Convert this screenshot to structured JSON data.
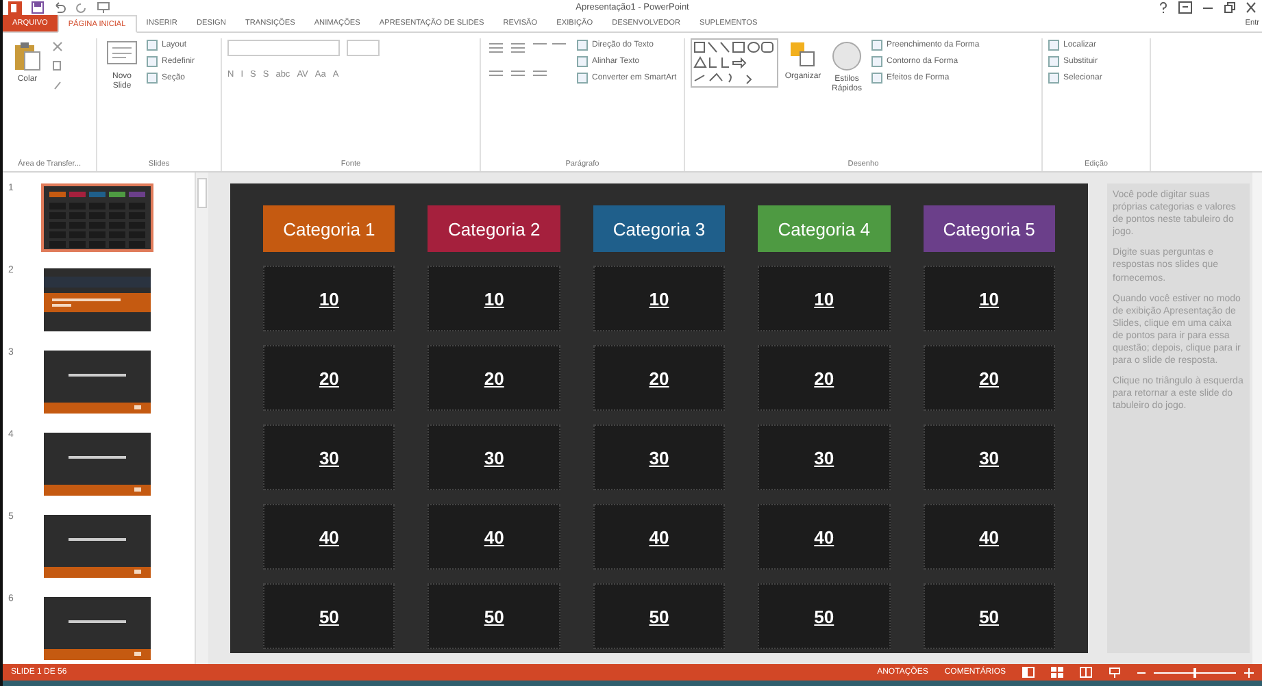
{
  "window": {
    "title": "Apresentação1 - PowerPoint"
  },
  "ribbon_tabs": [
    {
      "label": "ARQUIVO",
      "kind": "file",
      "selected": false
    },
    {
      "label": "PÁGINA INICIAL",
      "kind": "tab",
      "selected": true
    },
    {
      "label": "INSERIR",
      "kind": "tab",
      "selected": false
    },
    {
      "label": "DESIGN",
      "kind": "tab",
      "selected": false
    },
    {
      "label": "TRANSIÇÕES",
      "kind": "tab",
      "selected": false
    },
    {
      "label": "ANIMAÇÕES",
      "kind": "tab",
      "selected": false
    },
    {
      "label": "APRESENTAÇÃO DE SLIDES",
      "kind": "tab",
      "selected": false
    },
    {
      "label": "REVISÃO",
      "kind": "tab",
      "selected": false
    },
    {
      "label": "EXIBIÇÃO",
      "kind": "tab",
      "selected": false
    },
    {
      "label": "DESENVOLVEDOR",
      "kind": "tab",
      "selected": false
    },
    {
      "label": "SUPLEMENTOS",
      "kind": "tab",
      "selected": false
    }
  ],
  "account": "Entr",
  "ribbon_groups": [
    {
      "label": "Área de Transfer...",
      "kind": "clipboard",
      "large": [
        "Colar"
      ]
    },
    {
      "label": "Slides",
      "kind": "slides",
      "large": [
        "Novo Slide"
      ],
      "small": [
        "Layout",
        "Redefinir",
        "Seção"
      ]
    },
    {
      "label": "Fonte",
      "kind": "font",
      "format": [
        "N",
        "I",
        "S",
        "S",
        "abc",
        "AV",
        "Aa",
        "A"
      ]
    },
    {
      "label": "Parágrafo",
      "kind": "paragraph",
      "small": [
        "Direção do Texto",
        "Alinhar Texto",
        "Converter em SmartArt"
      ]
    },
    {
      "label": "Desenho",
      "kind": "drawing",
      "large": [
        "Organizar",
        "Estilos Rápidos"
      ],
      "small": [
        "Preenchimento da Forma",
        "Contorno da Forma",
        "Efeitos de Forma"
      ]
    },
    {
      "label": "Edição",
      "kind": "editing",
      "small": [
        "Localizar",
        "Substituir",
        "Selecionar"
      ]
    }
  ],
  "slides": [
    {
      "number": "1",
      "kind": "board",
      "selected": true
    },
    {
      "number": "2",
      "kind": "intro",
      "selected": false
    },
    {
      "number": "3",
      "kind": "question",
      "selected": false
    },
    {
      "number": "4",
      "kind": "question",
      "selected": false
    },
    {
      "number": "5",
      "kind": "question",
      "selected": false
    },
    {
      "number": "6",
      "kind": "question",
      "selected": false
    }
  ],
  "board": {
    "categories": [
      {
        "label": "Categoria 1",
        "color": "#c55a11"
      },
      {
        "label": "Categoria 2",
        "color": "#a5203d"
      },
      {
        "label": "Categoria 3",
        "color": "#1f5f8b"
      },
      {
        "label": "Categoria 4",
        "color": "#4e9a42"
      },
      {
        "label": "Categoria 5",
        "color": "#6b3f8a"
      }
    ],
    "rows": [
      [
        "10",
        "10",
        "10",
        "10",
        "10"
      ],
      [
        "20",
        "20",
        "20",
        "20",
        "20"
      ],
      [
        "30",
        "30",
        "30",
        "30",
        "30"
      ],
      [
        "40",
        "40",
        "40",
        "40",
        "40"
      ],
      [
        "50",
        "50",
        "50",
        "50",
        "50"
      ]
    ]
  },
  "notes": [
    "Você pode digitar suas próprias categorias e valores de pontos neste tabuleiro do jogo.",
    "Digite suas perguntas e respostas nos slides que fornecemos.",
    "Quando você estiver no modo de exibição Apresentação de Slides, clique em uma caixa de pontos para ir para essa questão; depois, clique para ir para o slide de resposta.",
    "Clique no triângulo à esquerda para retornar a este slide do tabuleiro do jogo."
  ],
  "status_bar": {
    "slide": "SLIDE 1 DE 56",
    "notes": "ANOTAÇÕES",
    "comments": "COMENTÁRIOS",
    "zoom": {
      "level": 0.5
    }
  }
}
